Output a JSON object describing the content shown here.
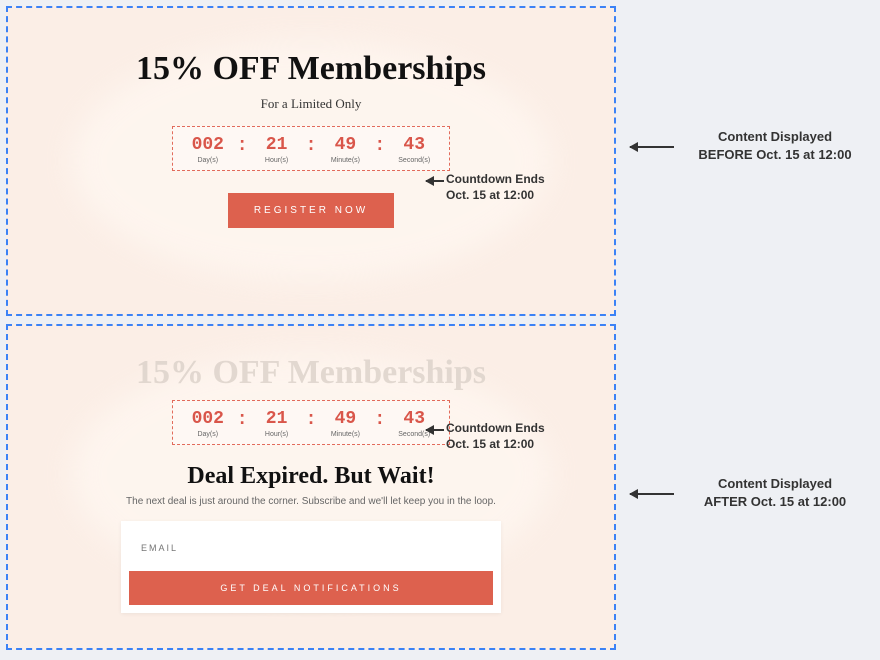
{
  "before": {
    "headline": "15% OFF Memberships",
    "subline": "For a Limited Only",
    "cta": "REGISTER NOW"
  },
  "after": {
    "headline": "15% OFF Memberships",
    "expired_title": "Deal Expired. But Wait!",
    "expired_sub": "The next deal is just around the corner. Subscribe and we'll let keep you in the loop.",
    "email_placeholder": "EMAIL",
    "notif_cta": "GET DEAL NOTIFICATIONS"
  },
  "countdown": {
    "days": "002",
    "hours": "21",
    "minutes": "49",
    "seconds": "43",
    "label_days": "Day(s)",
    "label_hours": "Hour(s)",
    "label_minutes": "Minute(s)",
    "label_seconds": "Second(s)",
    "sep": ":"
  },
  "annotations": {
    "countdown_note_line1": "Countdown Ends",
    "countdown_note_line2": "Oct. 15 at 12:00",
    "before_label_line1": "Content Displayed",
    "before_label_line2": "BEFORE Oct. 15 at 12:00",
    "after_label_line1": "Content Displayed",
    "after_label_line2": "AFTER Oct. 15 at 12:00"
  }
}
